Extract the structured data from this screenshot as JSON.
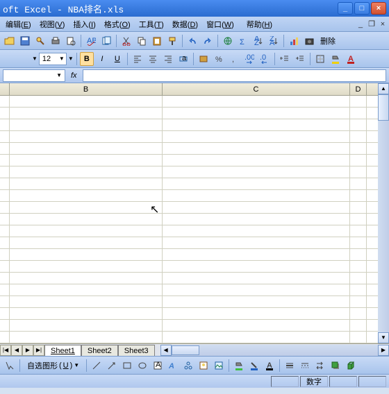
{
  "title": "oft Excel - NBA排名.xls",
  "menus": {
    "edit": "编辑",
    "edit_key": "E",
    "view": "视图",
    "view_key": "V",
    "insert": "插入",
    "insert_key": "I",
    "format": "格式",
    "format_key": "O",
    "tools": "工具",
    "tools_key": "T",
    "data": "数据",
    "data_key": "D",
    "window": "窗口",
    "window_key": "W",
    "help": "帮助",
    "help_key": "H"
  },
  "toolbar": {
    "font_size": "12",
    "bold": "B",
    "italic": "I",
    "underline": "U",
    "delete_label": "删除"
  },
  "formula": {
    "name_value": "",
    "fx": "fx",
    "formula_value": ""
  },
  "columns": {
    "b": "B",
    "c": "C",
    "d": "D"
  },
  "sheets": {
    "s1": "Sheet1",
    "s2": "Sheet2",
    "s3": "Sheet3"
  },
  "drawing": {
    "autoshapes": "自选图形",
    "autoshapes_key": "U"
  },
  "status": {
    "num": "数字"
  }
}
